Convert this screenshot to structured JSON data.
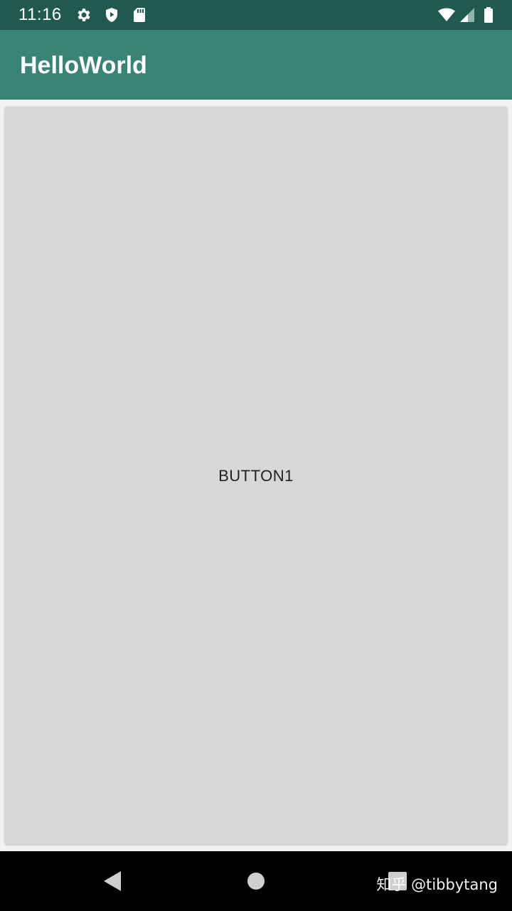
{
  "status_bar": {
    "time": "11:16",
    "icons_left": [
      "gear-icon",
      "shield-play-icon",
      "sd-card-icon"
    ],
    "icons_right": [
      "wifi-icon",
      "cellular-signal-icon",
      "battery-icon"
    ]
  },
  "app_bar": {
    "title": "HelloWorld"
  },
  "main": {
    "button_label": "BUTTON1"
  },
  "nav_bar": {
    "buttons": [
      "back-icon",
      "home-icon",
      "recents-icon"
    ],
    "watermark": "知乎 @tibbytang"
  },
  "colors": {
    "status_bar_bg": "#205a4f",
    "app_bar_bg": "#3a8477",
    "button_bg": "#d6d7d7",
    "page_bg": "#f2f2f2",
    "nav_bar_bg": "#000000"
  }
}
